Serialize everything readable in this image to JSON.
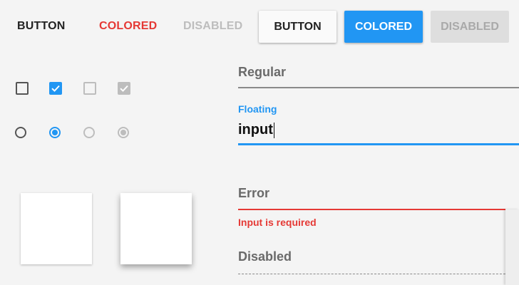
{
  "buttons": {
    "flat": "BUTTON",
    "flat_colored": "COLORED",
    "flat_disabled": "DISABLED",
    "raised": "BUTTON",
    "raised_colored": "COLORED",
    "raised_disabled": "DISABLED"
  },
  "checkboxes": [
    {
      "checked": false,
      "disabled": false
    },
    {
      "checked": true,
      "disabled": false
    },
    {
      "checked": false,
      "disabled": true
    },
    {
      "checked": true,
      "disabled": true
    }
  ],
  "radios": [
    {
      "selected": false,
      "disabled": false
    },
    {
      "selected": true,
      "disabled": false
    },
    {
      "selected": false,
      "disabled": true
    },
    {
      "selected": true,
      "disabled": true
    }
  ],
  "fields": {
    "regular": {
      "placeholder": "Regular"
    },
    "floating": {
      "label": "Floating",
      "value": "input"
    },
    "error": {
      "placeholder": "Error",
      "message": "Input is required"
    },
    "disabled": {
      "placeholder": "Disabled"
    }
  },
  "colors": {
    "accent": "#2196f3",
    "error": "#e53935",
    "disabled": "#bdbdbd",
    "background": "#f4f4f4"
  }
}
